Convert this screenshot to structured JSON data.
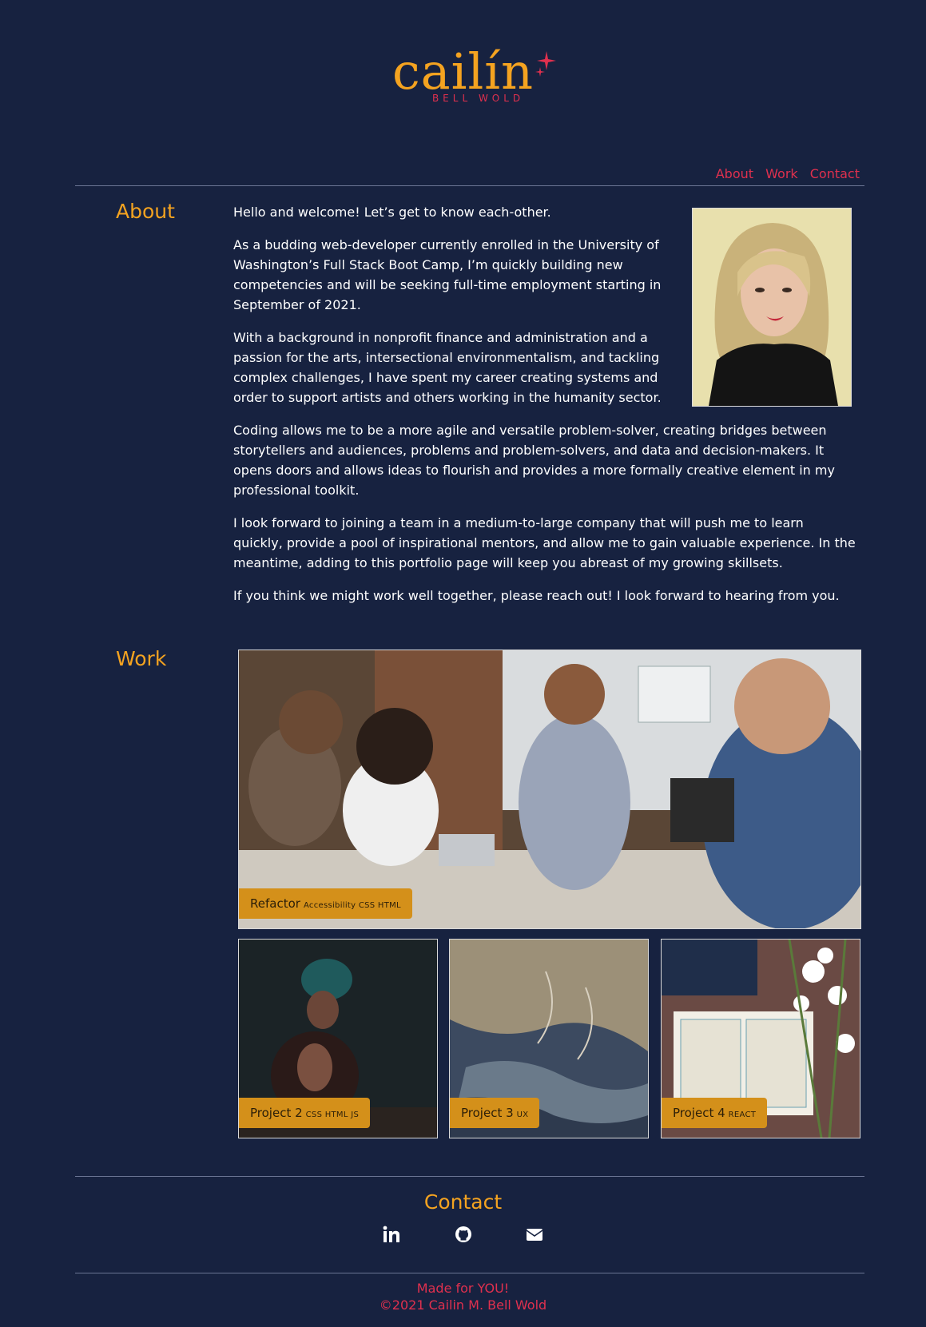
{
  "logo": {
    "name": "cailín",
    "subtitle": "BELL WOLD"
  },
  "nav": {
    "about": "About",
    "work": "Work",
    "contact": "Contact"
  },
  "about": {
    "title": "About",
    "paragraphs": [
      "Hello and welcome! Let’s get to know each-other.",
      "As a budding web-developer currently enrolled in the University of Washington’s Full Stack Boot Camp, I’m quickly building new competencies and will be seeking full-time employment starting in September of 2021.",
      "With a background in nonprofit finance and administration and a passion for the arts, intersectional environmentalism, and tackling complex challenges, I have spent my career creating systems and order to support artists and others working in the humanity sector.",
      "Coding allows me to be a more agile and versatile problem-solver, creating bridges between storytellers and audiences, problems and problem-solvers, and data and decision-makers. It opens doors and allows ideas to flourish and provides a more formally creative element in my professional toolkit.",
      "I look forward to joining a team in a medium-to-large company that will push me to learn quickly, provide a pool of inspirational mentors, and allow me to gain valuable experience. In the meantime, adding to this portfolio page will keep you abreast of my growing skillsets.",
      "If you think we might work well together, please reach out! I look forward to hearing from you."
    ]
  },
  "work": {
    "title": "Work",
    "featured": {
      "name": "Refactor",
      "tags": "Accessibility CSS HTML"
    },
    "projects": [
      {
        "name": "Project 2",
        "tags": "CSS HTML JS"
      },
      {
        "name": "Project 3",
        "tags": "UX"
      },
      {
        "name": "Project 4",
        "tags": "REACT"
      }
    ]
  },
  "contact": {
    "title": "Contact",
    "icons": [
      "linkedin-icon",
      "github-icon",
      "envelope-icon"
    ]
  },
  "footer": {
    "line1": "Made for YOU!",
    "line2": "©2021 Cailin M. Bell Wold"
  },
  "colors": {
    "background": "#172240",
    "accent_orange": "#f4a320",
    "accent_red": "#e0304e",
    "label_bg": "#d4901a"
  }
}
